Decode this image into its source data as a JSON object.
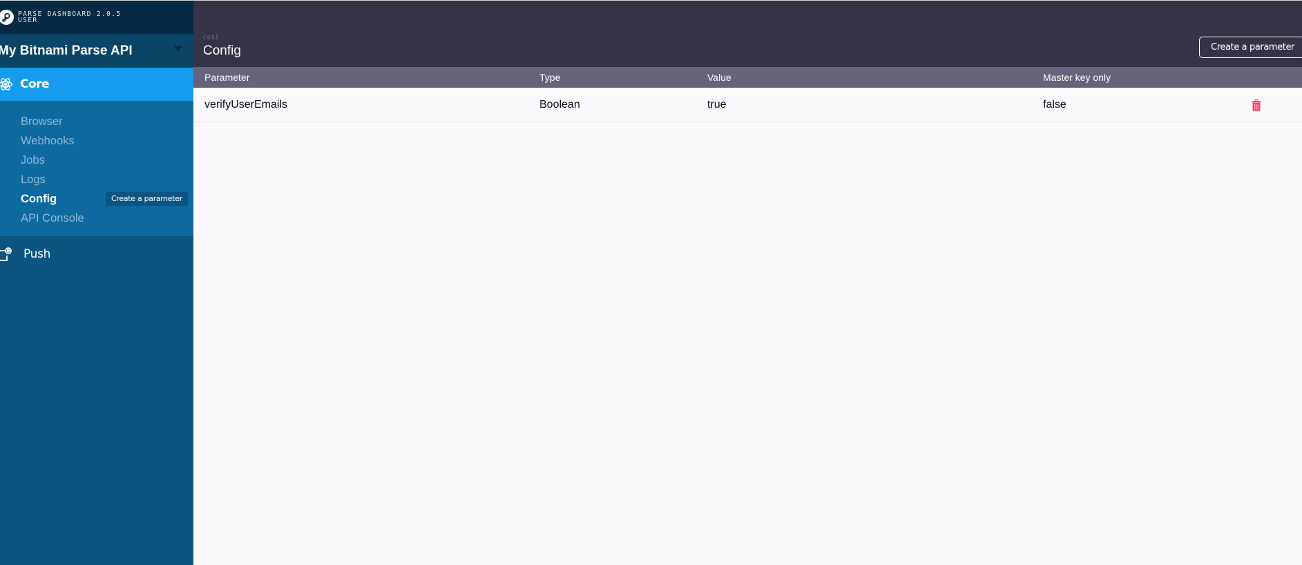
{
  "sidebar": {
    "brand": {
      "line1": "PARSE DASHBOARD 2.0.5",
      "line2": "USER",
      "icon": "parse-logo-icon"
    },
    "app_switcher": {
      "app_name": "My Bitnami Parse API",
      "icon": "caret-down-icon"
    },
    "sections": [
      {
        "label": "Core",
        "icon": "atom-icon",
        "active": true,
        "items": [
          {
            "label": "Browser",
            "active": false
          },
          {
            "label": "Webhooks",
            "active": false
          },
          {
            "label": "Jobs",
            "active": false
          },
          {
            "label": "Logs",
            "active": false
          },
          {
            "label": "Config",
            "active": true,
            "action_label": "Create a parameter"
          },
          {
            "label": "API Console",
            "active": false
          }
        ]
      },
      {
        "label": "Push",
        "icon": "push-notification-icon",
        "active": false
      }
    ]
  },
  "header": {
    "section": "CORE",
    "title": "Config",
    "create_button_label": "Create a parameter"
  },
  "table": {
    "columns": [
      "Parameter",
      "Type",
      "Value",
      "Master key only"
    ],
    "rows": [
      {
        "parameter": "verifyUserEmails",
        "type": "Boolean",
        "value": "true",
        "master_key_only": "false",
        "delete_icon": "trash-icon"
      }
    ]
  },
  "colors": {
    "sidebar_bg": "#0c5582",
    "sidebar_header_bg": "#062a41",
    "app_switcher_bg": "#0a4466",
    "core_active_bg": "#169cee",
    "subnav_bg": "#0e69a1",
    "main_header_bg": "#353446",
    "table_header_bg": "#66637a",
    "content_bg": "#fbf9fb",
    "delete_red": "#ff395e"
  }
}
